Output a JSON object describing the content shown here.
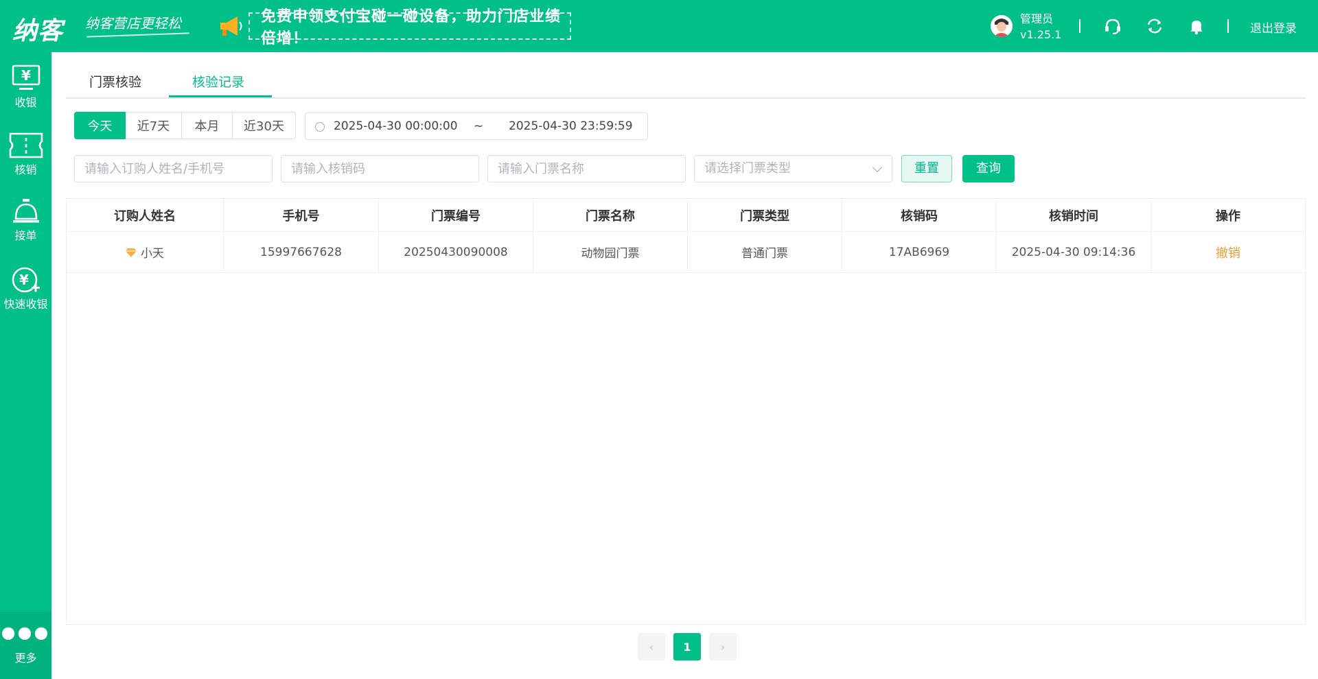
{
  "header": {
    "logo": "纳客",
    "slogan": "纳客营店更轻松",
    "promo": "免费申领支付宝碰一碰设备，助力门店业绩倍增！",
    "user_name": "管理员",
    "version": "v1.25.1",
    "logout": "退出登录",
    "icons": [
      "support-icon",
      "sync-icon",
      "bell-icon"
    ]
  },
  "sidebar": {
    "items": [
      {
        "label": "收银",
        "icon": "cashier-icon"
      },
      {
        "label": "核销",
        "icon": "ticket-icon"
      },
      {
        "label": "接单",
        "icon": "service-bell-icon"
      },
      {
        "label": "快速收银",
        "icon": "quick-cashier-icon"
      }
    ],
    "more": "更多"
  },
  "tabs": [
    "门票核验",
    "核验记录"
  ],
  "active_tab": "核验记录",
  "quick_dates": [
    "今天",
    "近7天",
    "本月",
    "近30天"
  ],
  "active_quick_date": "今天",
  "date_range": {
    "start": "2025-04-30 00:00:00",
    "separator": "~",
    "end": "2025-04-30 23:59:59"
  },
  "filters": {
    "buyer_placeholder": "请输入订购人姓名/手机号",
    "code_placeholder": "请输入核销码",
    "ticket_name_placeholder": "请输入门票名称",
    "ticket_type_placeholder": "请选择门票类型",
    "reset": "重置",
    "query": "查询"
  },
  "table": {
    "columns": [
      "订购人姓名",
      "手机号",
      "门票编号",
      "门票名称",
      "门票类型",
      "核销码",
      "核销时间",
      "操作"
    ],
    "rows": [
      {
        "name": "小天",
        "phone": "15997667628",
        "ticket_no": "20250430090008",
        "ticket_name": "动物园门票",
        "ticket_type": "普通门票",
        "code": "17AB6969",
        "time": "2025-04-30 09:14:36",
        "action": "撤销"
      }
    ]
  },
  "pagination": {
    "prev": "‹",
    "current": "1",
    "next": "›"
  },
  "colors": {
    "brand": "#00c087",
    "action": "#e6a23c"
  }
}
